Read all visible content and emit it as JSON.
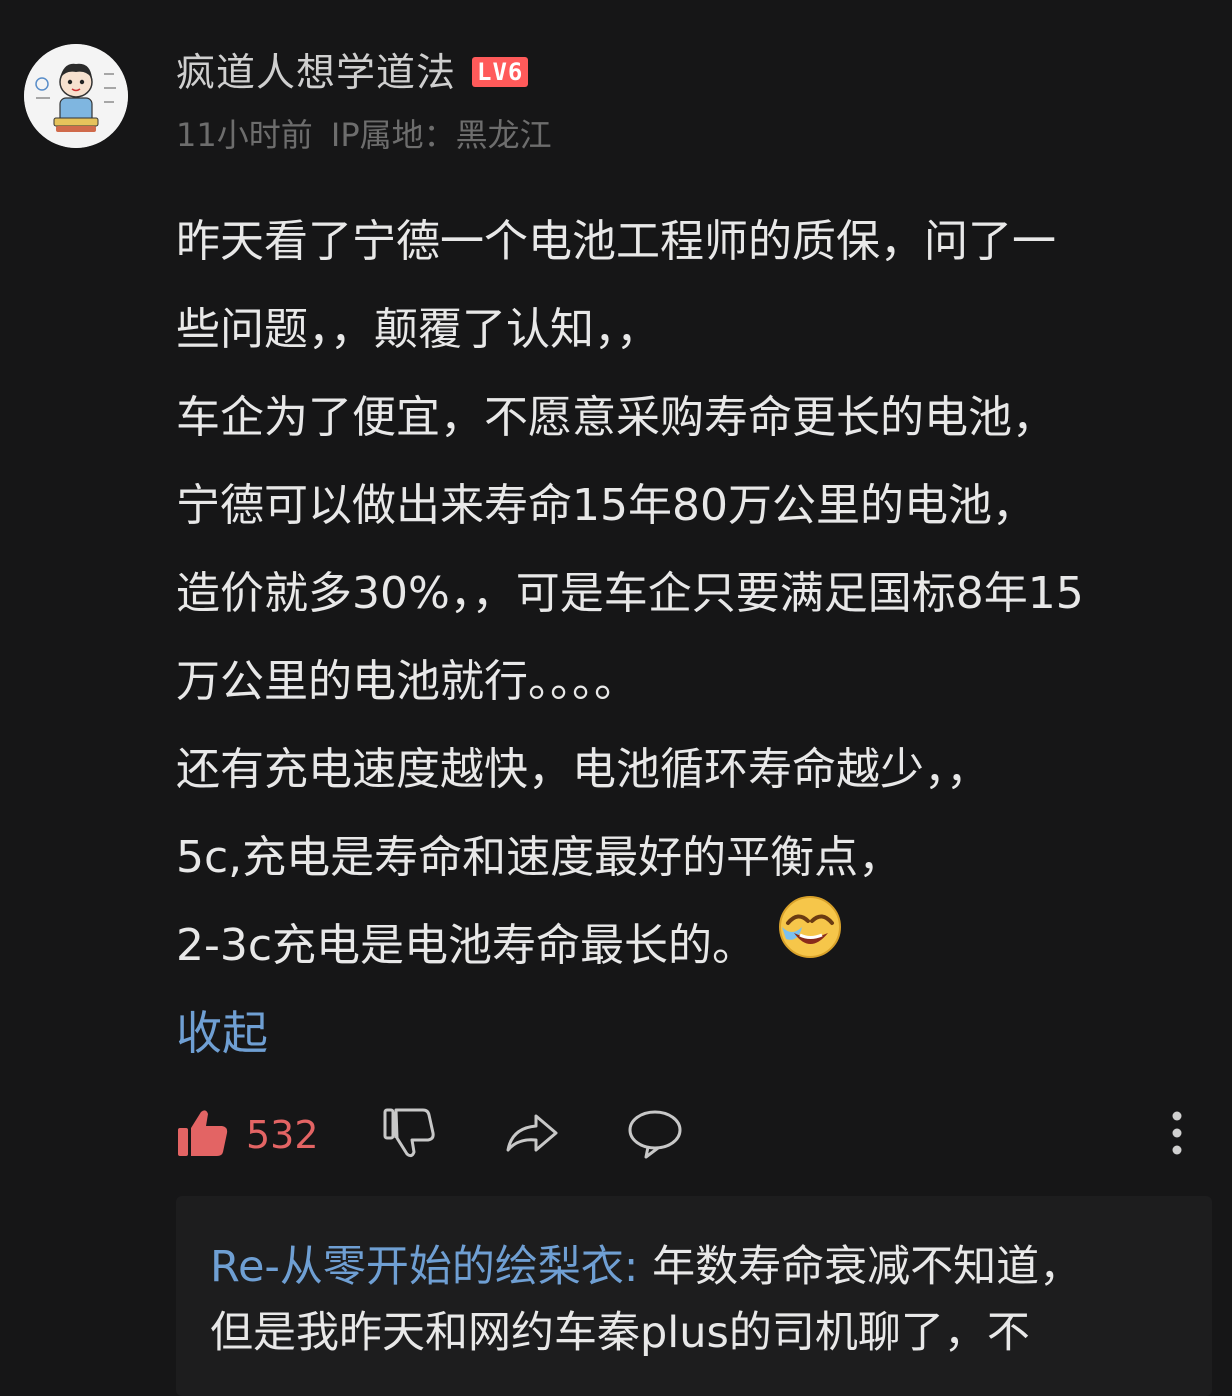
{
  "comment": {
    "user_name": "疯道人想学道法",
    "level_badge": "LV6",
    "time": "11小时前",
    "ip_location": "IP属地：黑龙江",
    "lines": [
      "昨天看了宁德一个电池工程师的质保，问了一",
      "些问题，，颠覆了认知，，",
      "车企为了便宜，不愿意采购寿命更长的电池，",
      "宁德可以做出来寿命15年80万公里的电池，",
      "造价就多30%，，可是车企只要满足国标8年15",
      "万公里的电池就行。。。。",
      "还有充电速度越快，电池循环寿命越少，，",
      "5c,充电是寿命和速度最好的平衡点，",
      "2-3c充电是电池寿命最长的。"
    ],
    "emoji": "crying-laughing-emoji",
    "collapse_label": "收起",
    "like_count": "532"
  },
  "reply": {
    "author": "Re-从零开始的绘梨衣",
    "separator": ": ",
    "line1_text": "年数寿命衰减不知道，",
    "line2_text": "但是我昨天和网约车秦plus的司机聊了，不"
  },
  "colors": {
    "background": "#161617",
    "link_blue": "#6f9fd3",
    "like_red": "#e36464",
    "badge_red": "#ff5a5a"
  }
}
